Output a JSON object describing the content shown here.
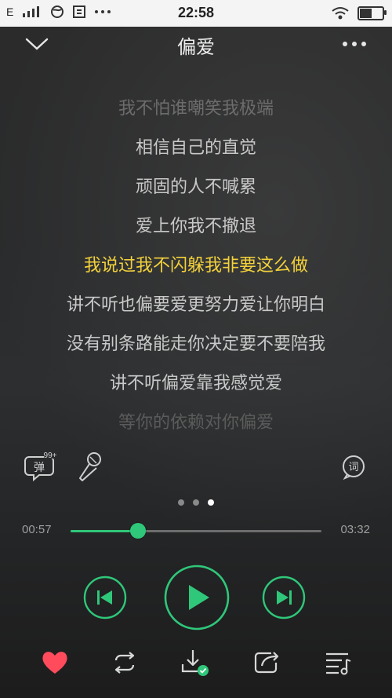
{
  "status_bar": {
    "network": "E",
    "time": "22:58"
  },
  "header": {
    "title": "偏爱"
  },
  "lyrics": [
    "我不怕谁嘲笑我极端",
    "相信自己的直觉",
    "顽固的人不喊累",
    "爱上你我不撤退",
    "我说过我不闪躲我非要这么做",
    "讲不听也偏要爱更努力爱让你明白",
    "没有别条路能走你决定要不要陪我",
    "讲不听偏爱靠我感觉爱",
    "等你的依赖对你偏爱"
  ],
  "active_lyric_index": 4,
  "tools": {
    "danmu_label": "弹",
    "danmu_count": "99+",
    "lyric_label": "词"
  },
  "pager": {
    "pages": 3,
    "active": 2
  },
  "progress": {
    "elapsed": "00:57",
    "total": "03:32",
    "fraction": 0.2689
  },
  "colors": {
    "accent": "#2fc77a",
    "active_lyric": "#f2d13b",
    "heart": "#ff4b5c"
  },
  "icons": {
    "back": "chevron-down-icon",
    "more": "more-dots-icon",
    "danmu": "danmu-bubble-icon",
    "mic": "microphone-icon",
    "lyric": "lyric-bubble-icon",
    "prev": "skip-previous-icon",
    "play": "play-icon",
    "next": "skip-next-icon",
    "favorite": "heart-icon",
    "loop": "repeat-icon",
    "download": "downloaded-icon",
    "share": "share-icon",
    "playlist": "playlist-icon"
  }
}
